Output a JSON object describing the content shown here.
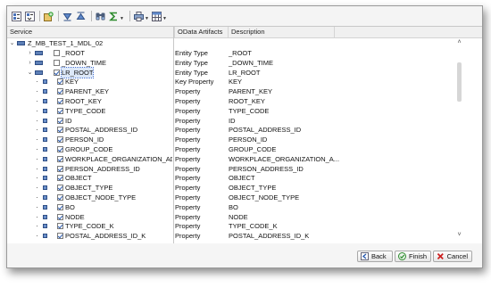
{
  "toolbar": {
    "buttons": [
      {
        "icon": "expand-all-icon"
      },
      {
        "icon": "collapse-all-icon"
      },
      {
        "icon": "add-node-icon"
      },
      {
        "icon": "move-down-icon"
      },
      {
        "icon": "move-up-icon"
      },
      {
        "icon": "find-icon"
      },
      {
        "icon": "sum-icon"
      },
      {
        "icon": "print-icon"
      },
      {
        "icon": "layout-grid-icon"
      }
    ]
  },
  "columns": {
    "service": "Service",
    "artifacts": "OData Artifacts",
    "description": "Description"
  },
  "tree": {
    "root_label": "Z_MB_TEST_1_MDL_02",
    "rows": [
      {
        "label": "_ROOT",
        "artifact": "Entity Type",
        "description": "_ROOT",
        "expander": "›",
        "checked": false,
        "type": "entity"
      },
      {
        "label": "_DOWN_TIME",
        "artifact": "Entity Type",
        "description": "_DOWN_TIME",
        "expander": "›",
        "checked": false,
        "type": "entity"
      },
      {
        "label": "LR_ROOT",
        "artifact": "Entity Type",
        "description": "LR_ROOT",
        "expander": "⌄",
        "checked": true,
        "type": "entity",
        "selected": true
      },
      {
        "label": "KEY",
        "artifact": "Key Property",
        "description": "KEY",
        "checked": true,
        "type": "property"
      },
      {
        "label": "PARENT_KEY",
        "artifact": "Property",
        "description": "PARENT_KEY",
        "checked": true,
        "type": "property"
      },
      {
        "label": "ROOT_KEY",
        "artifact": "Property",
        "description": "ROOT_KEY",
        "checked": true,
        "type": "property"
      },
      {
        "label": "TYPE_CODE",
        "artifact": "Property",
        "description": "TYPE_CODE",
        "checked": true,
        "type": "property"
      },
      {
        "label": "ID",
        "artifact": "Property",
        "description": "ID",
        "checked": true,
        "type": "property"
      },
      {
        "label": "POSTAL_ADDRESS_ID",
        "artifact": "Property",
        "description": "POSTAL_ADDRESS_ID",
        "checked": true,
        "type": "property"
      },
      {
        "label": "PERSON_ID",
        "artifact": "Property",
        "description": "PERSON_ID",
        "checked": true,
        "type": "property"
      },
      {
        "label": "GROUP_CODE",
        "artifact": "Property",
        "description": "GROUP_CODE",
        "checked": true,
        "type": "property"
      },
      {
        "label": "WORKPLACE_ORGANIZATION_ADDI",
        "artifact": "Property",
        "description": "WORKPLACE_ORGANIZATION_A...",
        "checked": true,
        "type": "property"
      },
      {
        "label": "PERSON_ADDRESS_ID",
        "artifact": "Property",
        "description": "PERSON_ADDRESS_ID",
        "checked": true,
        "type": "property"
      },
      {
        "label": "OBJECT",
        "artifact": "Property",
        "description": "OBJECT",
        "checked": true,
        "type": "property"
      },
      {
        "label": "OBJECT_TYPE",
        "artifact": "Property",
        "description": "OBJECT_TYPE",
        "checked": true,
        "type": "property"
      },
      {
        "label": "OBJECT_NODE_TYPE",
        "artifact": "Property",
        "description": "OBJECT_NODE_TYPE",
        "checked": true,
        "type": "property"
      },
      {
        "label": "BO",
        "artifact": "Property",
        "description": "BO",
        "checked": true,
        "type": "property"
      },
      {
        "label": "NODE",
        "artifact": "Property",
        "description": "NODE",
        "checked": true,
        "type": "property"
      },
      {
        "label": "TYPE_CODE_K",
        "artifact": "Property",
        "description": "TYPE_CODE_K",
        "checked": true,
        "type": "property"
      },
      {
        "label": "POSTAL_ADDRESS_ID_K",
        "artifact": "Property",
        "description": "POSTAL_ADDRESS_ID_K",
        "checked": true,
        "type": "property"
      }
    ]
  },
  "scroll": {
    "up": "˄",
    "down": "˅",
    "left": "<",
    "right": ">"
  },
  "footer": {
    "back_label": "Back",
    "finish_label": "Finish",
    "cancel_label": "Cancel"
  },
  "colors": {
    "accent": "#2a5bb0",
    "selection": "#dde8f8",
    "cancel_x": "#cc1f1f",
    "finish_check": "#2e8b2e"
  }
}
